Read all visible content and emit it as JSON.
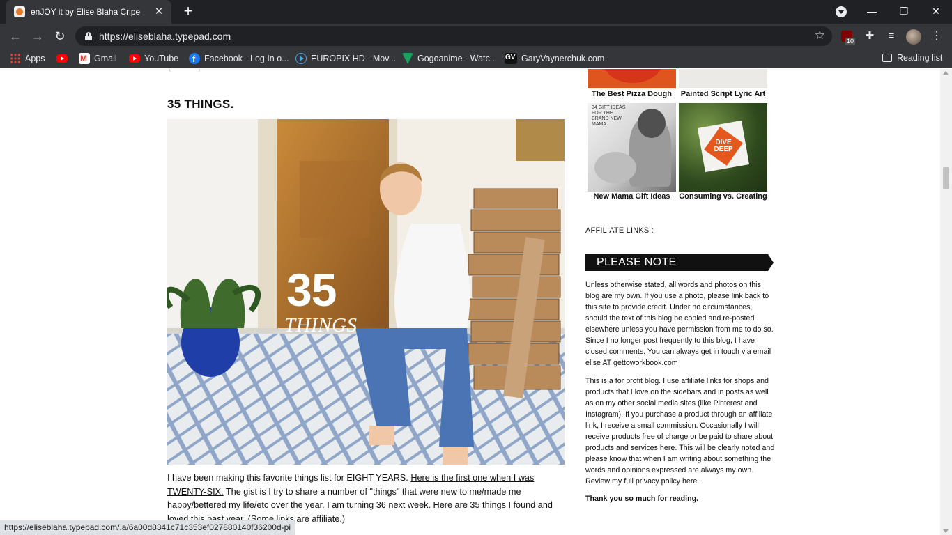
{
  "browser": {
    "tab_title": "enJOY it by Elise Blaha Cripe",
    "url": "https://eliseblaha.typepad.com",
    "extension_badge": "10",
    "bookmarks": [
      {
        "label": "Apps",
        "icon": "apps-grid-icon"
      },
      {
        "label": "",
        "icon": "youtube-icon"
      },
      {
        "label": "Gmail",
        "icon": "gmail-icon"
      },
      {
        "label": "YouTube",
        "icon": "youtube-icon"
      },
      {
        "label": "Facebook - Log In o...",
        "icon": "facebook-icon"
      },
      {
        "label": "EUROPIX HD - Mov...",
        "icon": "europix-icon"
      },
      {
        "label": "Gogoanime - Watc...",
        "icon": "gogoanime-icon"
      },
      {
        "label": "GaryVaynerchuk.com",
        "icon": "gv-icon"
      }
    ],
    "reading_list": "Reading list",
    "status_url": "https://eliseblaha.typepad.com/.a/6a00d8341c71c353ef027880140f36200d-pi"
  },
  "post": {
    "title": "35 THINGS.",
    "hero_number": "35",
    "hero_word": "THINGS",
    "body_intro": "I have been making this favorite things list for EIGHT YEARS. ",
    "body_link": "Here is the first one when I was TWENTY-SIX.",
    "body_rest": " The gist is I try to share a number of \"things\" that were new to me/made me happy/bettered my life/etc over the year. I am turning 36 next week. Here are 35 things I found and loved this past year. (Some links are affiliate.)"
  },
  "sidebar": {
    "thumbs": [
      {
        "caption": "The Best Pizza Dough",
        "image": "pizza-thumbnail"
      },
      {
        "caption": "Painted Script Lyric Art",
        "image": "lyric-art-thumbnail"
      },
      {
        "caption": "New Mama Gift Ideas",
        "image": "mama-gift-thumbnail",
        "overlay": "34 GIFT IDEAS FOR THE BRAND NEW MAMA"
      },
      {
        "caption": "Consuming vs. Creating",
        "image": "dive-deep-thumbnail",
        "overlay": "DIVE DEEP"
      }
    ],
    "affiliate_label": "AFFILIATE LINKS :",
    "please_note": "PLEASE NOTE",
    "note_para_1": "Unless otherwise stated, all words and photos on this blog are my own. If you use a photo, please link back to this site to provide credit. Under no circumstances, should the text of this blog be copied and re-posted elsewhere unless you have permission from me to do so. Since I no longer post frequently to this blog, I have closed comments. You can always get in touch via email elise AT gettoworkbook.com",
    "note_para_2_text": "This is a for profit blog. I use affiliate links for shops and products that I love on the sidebars and in posts as well as on my other social media sites (like Pinterest and Instagram). If you purchase a product through an affiliate link, I receive a small commission. Occasionally I will receive products free of charge or be paid to share about products and services here. This will be clearly noted and please know that when I am writing about something the words and opinions expressed are always my own. Review my full privacy policy ",
    "note_para_2_link": "here",
    "note_para_2_end": ".",
    "thanks": "Thank you so much for reading."
  }
}
